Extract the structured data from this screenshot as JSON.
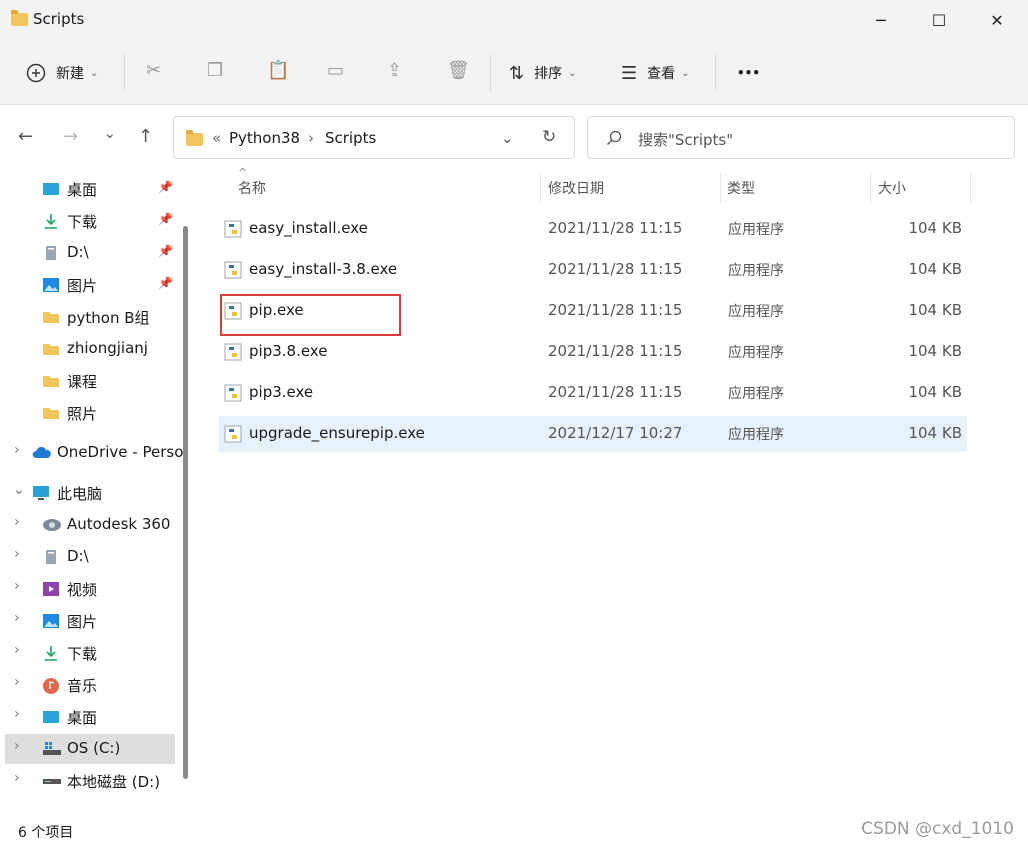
{
  "window": {
    "title": "Scripts",
    "minimize": "─",
    "maximize": "☐",
    "close": "✕"
  },
  "toolbar": {
    "new_label": "新建",
    "sort_label": "排序",
    "view_label": "查看",
    "more": "•••"
  },
  "nav": {
    "back": "←",
    "forward": "→",
    "recent": "⌄",
    "up": "↑"
  },
  "address": {
    "overflow": "«",
    "crumbs": [
      "Python38",
      "Scripts"
    ],
    "sep": "›",
    "dropdown": "⌄",
    "refresh": "↻"
  },
  "search": {
    "placeholder": "搜索\"Scripts\""
  },
  "sidebar": {
    "quick_access": [
      {
        "label": "桌面",
        "icon": "desktop-icon",
        "pinned": true
      },
      {
        "label": "下载",
        "icon": "download-icon",
        "pinned": true
      },
      {
        "label": "D:\\",
        "icon": "drive-icon",
        "pinned": true
      },
      {
        "label": "图片",
        "icon": "pictures-icon",
        "pinned": true
      },
      {
        "label": "python B组",
        "icon": "folder-icon"
      },
      {
        "label": "zhiongjianj",
        "icon": "folder-icon"
      },
      {
        "label": "课程",
        "icon": "folder-icon"
      },
      {
        "label": "照片",
        "icon": "folder-icon"
      }
    ],
    "onedrive": {
      "label": "OneDrive - Perso",
      "icon": "cloud-icon"
    },
    "this_pc": {
      "label": "此电脑",
      "icon": "computer-icon"
    },
    "pc_items": [
      {
        "label": "Autodesk 360",
        "icon": "autodesk-icon"
      },
      {
        "label": "D:\\",
        "icon": "drive-icon"
      },
      {
        "label": "视频",
        "icon": "video-icon"
      },
      {
        "label": "图片",
        "icon": "pictures-icon"
      },
      {
        "label": "下载",
        "icon": "download-icon"
      },
      {
        "label": "音乐",
        "icon": "music-icon"
      },
      {
        "label": "桌面",
        "icon": "desktop-icon"
      },
      {
        "label": "OS (C:)",
        "icon": "os-drive-icon",
        "selected": true
      },
      {
        "label": "本地磁盘 (D:)",
        "icon": "disk-icon"
      }
    ]
  },
  "columns": {
    "name": "名称",
    "date": "修改日期",
    "type": "类型",
    "size": "大小"
  },
  "files": [
    {
      "name": "easy_install.exe",
      "date": "2021/11/28 11:15",
      "type": "应用程序",
      "size": "104 KB"
    },
    {
      "name": "easy_install-3.8.exe",
      "date": "2021/11/28 11:15",
      "type": "应用程序",
      "size": "104 KB"
    },
    {
      "name": "pip.exe",
      "date": "2021/11/28 11:15",
      "type": "应用程序",
      "size": "104 KB",
      "highlighted": true
    },
    {
      "name": "pip3.8.exe",
      "date": "2021/11/28 11:15",
      "type": "应用程序",
      "size": "104 KB"
    },
    {
      "name": "pip3.exe",
      "date": "2021/11/28 11:15",
      "type": "应用程序",
      "size": "104 KB"
    },
    {
      "name": "upgrade_ensurepip.exe",
      "date": "2021/12/17 10:27",
      "type": "应用程序",
      "size": "104 KB",
      "selected": true
    }
  ],
  "status": {
    "count": "6 个项目"
  },
  "watermark": "CSDN @cxd_1010",
  "colors": {
    "accent": "#0067c0",
    "highlight_border": "#e03a3a",
    "selected_row": "#e5f1fb"
  }
}
